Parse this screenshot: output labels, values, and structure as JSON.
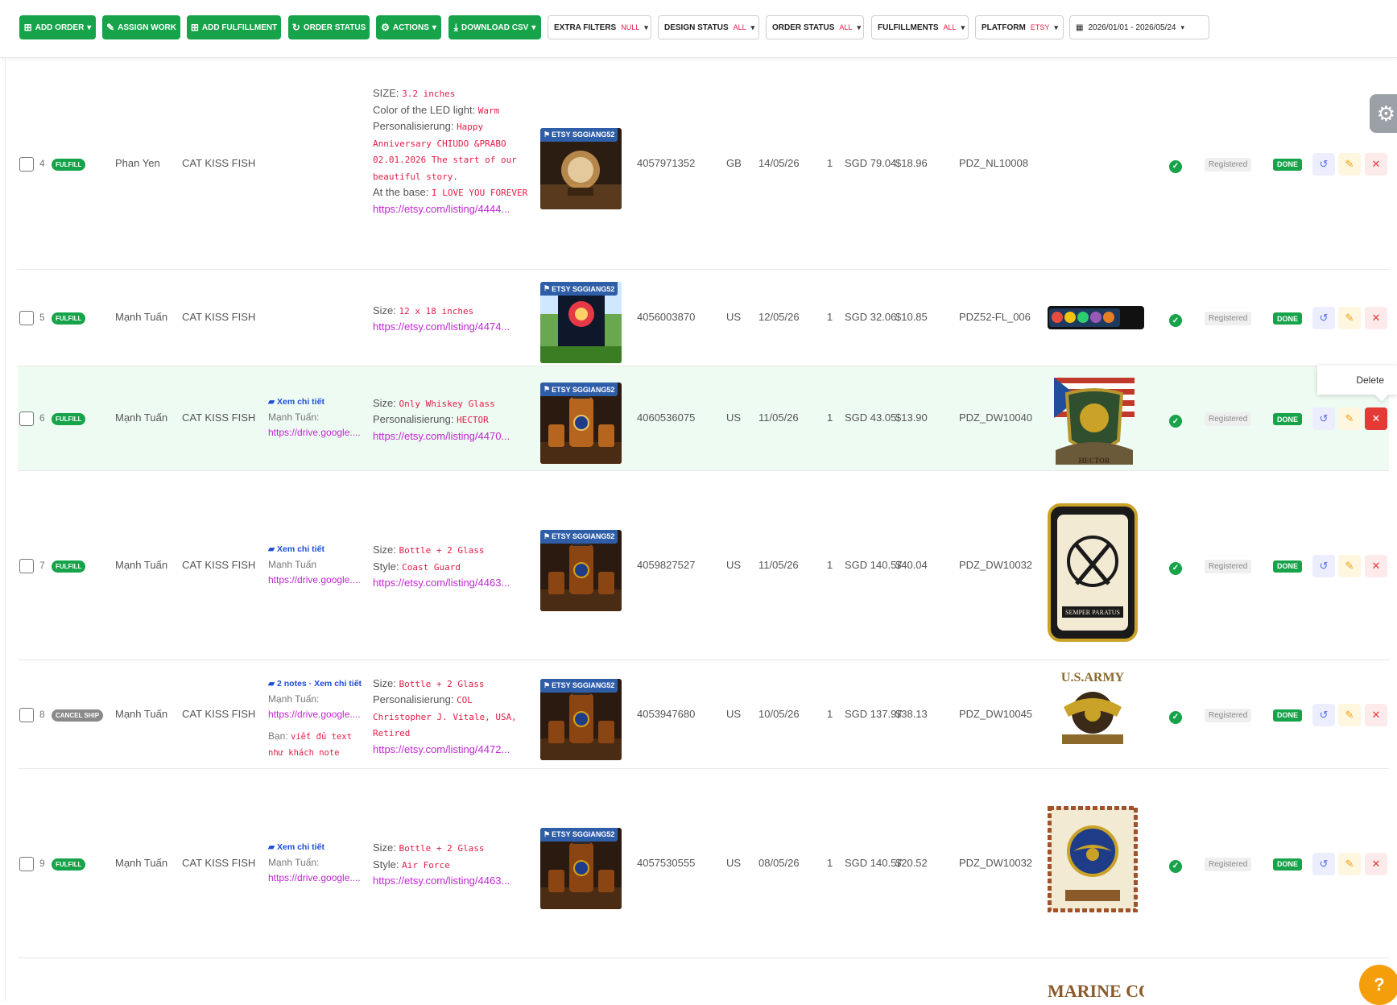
{
  "toolbar": {
    "buttons": [
      {
        "label": "ADD ORDER",
        "icon": "add-box-icon",
        "caret": true
      },
      {
        "label": "ASSIGN WORK",
        "icon": "assign-icon",
        "caret": false
      },
      {
        "label": "ADD FULFILLMENT",
        "icon": "add-box-icon",
        "caret": false
      },
      {
        "label": "ORDER STATUS",
        "icon": "sync-icon",
        "caret": false
      },
      {
        "label": "ACTIONS",
        "icon": "gear-icon",
        "caret": true
      },
      {
        "label": "DOWNLOAD CSV",
        "icon": "download-icon",
        "caret": true
      }
    ],
    "filters": [
      {
        "label": "EXTRA FILTERS",
        "value": "NULL"
      },
      {
        "label": "DESIGN STATUS",
        "value": "ALL"
      },
      {
        "label": "ORDER STATUS",
        "value": "ALL"
      },
      {
        "label": "FULFILLMENTS",
        "value": "ALL"
      },
      {
        "label": "PLATFORM",
        "value": "ETSY"
      }
    ],
    "date_range": "2026/01/01 - 2026/05/24"
  },
  "rows": [
    {
      "index": "4",
      "badge": "FULFILL",
      "seller": "Phan Yen",
      "store": "CAT KISS FISH",
      "note": null,
      "options": [
        {
          "k": "SIZE: ",
          "v": "3.2 inches"
        },
        {
          "k": "Color of the LED light: ",
          "v": "Warm"
        },
        {
          "k": "Personalisierung: ",
          "v": "Happy Anniversary CHIUDO &PRABO 02.01.2026 The start of our beautiful story."
        },
        {
          "k": "At the base: ",
          "v": "I LOVE YOU FOREVER"
        }
      ],
      "link": "https://etsy.com/listing/4444...",
      "platform_tag": "ETSY SGGIANG52",
      "order_id": "4057971352",
      "country": "GB",
      "date": "14/05/26",
      "qty": "1",
      "price": "SGD 79.04",
      "cost": "$18.96",
      "sku": "PDZ_NL10008",
      "design": null,
      "design_caption": "",
      "registered": "Registered",
      "status": "DONE"
    },
    {
      "index": "5",
      "badge": "FULFILL",
      "seller": "Mạnh Tuấn",
      "store": "CAT KISS FISH",
      "note": null,
      "options": [
        {
          "k": "Size: ",
          "v": "12 x 18 inches"
        }
      ],
      "link": "https://etsy.com/listing/4474...",
      "platform_tag": "ETSY SGGIANG52",
      "order_id": "4056003870",
      "country": "US",
      "date": "12/05/26",
      "qty": "1",
      "price": "SGD 32.06",
      "cost": "$10.85",
      "sku": "PDZ52-FL_006",
      "design": "banner",
      "design_caption": "",
      "registered": "Registered",
      "status": "DONE"
    },
    {
      "index": "6",
      "badge": "FULFILL",
      "seller": "Mạnh Tuấn",
      "store": "CAT KISS FISH",
      "note": {
        "head": "Xem chi tiết",
        "author": "Mạnh Tuấn:",
        "link": "https://drive.google....",
        "extra_label": "",
        "extra_text": ""
      },
      "options": [
        {
          "k": "Size: ",
          "v": "Only Whiskey Glass"
        },
        {
          "k": "Personalisierung: ",
          "v": "HECTOR"
        }
      ],
      "link": "https://etsy.com/listing/4470...",
      "platform_tag": "ETSY SGGIANG52",
      "order_id": "4060536075",
      "country": "US",
      "date": "11/05/26",
      "qty": "1",
      "price": "SGD 43.05",
      "cost": "$13.90",
      "sku": "PDZ_DW10040",
      "design": "crest-flag",
      "design_caption": "HECTOR",
      "registered": "Registered",
      "status": "DONE"
    },
    {
      "index": "7",
      "badge": "FULFILL",
      "seller": "Mạnh Tuấn",
      "store": "CAT KISS FISH",
      "note": {
        "head": "Xem chi tiết",
        "author": "Mạnh Tuấn",
        "link": "https://drive.google....",
        "extra_label": "",
        "extra_text": ""
      },
      "options": [
        {
          "k": "Size: ",
          "v": "Bottle + 2 Glass"
        },
        {
          "k": "Style: ",
          "v": "Coast Guard"
        }
      ],
      "link": "https://etsy.com/listing/4463...",
      "platform_tag": "ETSY SGGIANG52",
      "order_id": "4059827527",
      "country": "US",
      "date": "11/05/26",
      "qty": "1",
      "price": "SGD 140.57",
      "cost": "$40.04",
      "sku": "PDZ_DW10032",
      "design": "coast-guard",
      "design_caption": "SEMPER PARATUS",
      "registered": "Registered",
      "status": "DONE"
    },
    {
      "index": "8",
      "badge": "CANCEL SHIP",
      "seller": "Mạnh Tuấn",
      "store": "CAT KISS FISH",
      "note": {
        "head": "2 notes · Xem chi tiết",
        "author": "Mạnh Tuấn:",
        "link": "https://drive.google....",
        "extra_label": "Bạn: ",
        "extra_text": "viết đủ text như khách note"
      },
      "options": [
        {
          "k": "Size: ",
          "v": "Bottle + 2 Glass"
        },
        {
          "k": "Personalisierung: ",
          "v": "COL Christopher J. Vitale, USA, Retired"
        }
      ],
      "link": "https://etsy.com/listing/4472...",
      "platform_tag": "ETSY SGGIANG52",
      "order_id": "4053947680",
      "country": "US",
      "date": "10/05/26",
      "qty": "1",
      "price": "SGD 137.97",
      "cost": "$38.13",
      "sku": "PDZ_DW10045",
      "design": "us-army",
      "design_caption": "U.S. ARMY",
      "registered": "Registered",
      "status": "DONE"
    },
    {
      "index": "9",
      "badge": "FULFILL",
      "seller": "Mạnh Tuấn",
      "store": "CAT KISS FISH",
      "note": {
        "head": "Xem chi tiết",
        "author": "Mạnh Tuấn:",
        "link": "https://drive.google....",
        "extra_label": "",
        "extra_text": ""
      },
      "options": [
        {
          "k": "Size: ",
          "v": "Bottle + 2 Glass"
        },
        {
          "k": "Style: ",
          "v": "Air Force"
        }
      ],
      "link": "https://etsy.com/listing/4463...",
      "platform_tag": "ETSY SGGIANG52",
      "order_id": "4057530555",
      "country": "US",
      "date": "08/05/26",
      "qty": "1",
      "price": "SGD 140.57",
      "cost": "$20.52",
      "sku": "PDZ_DW10032",
      "design": "air-force",
      "design_caption": "",
      "registered": "Registered",
      "status": "DONE"
    }
  ],
  "tooltip": "Delete",
  "next_row_design_caption": "MARINE CORPS",
  "colors": {
    "green": "#16a34a",
    "red": "#e11d48",
    "pink": "#c026d3",
    "tag_blue": "#2f5ea8",
    "help": "#f59e0b"
  }
}
